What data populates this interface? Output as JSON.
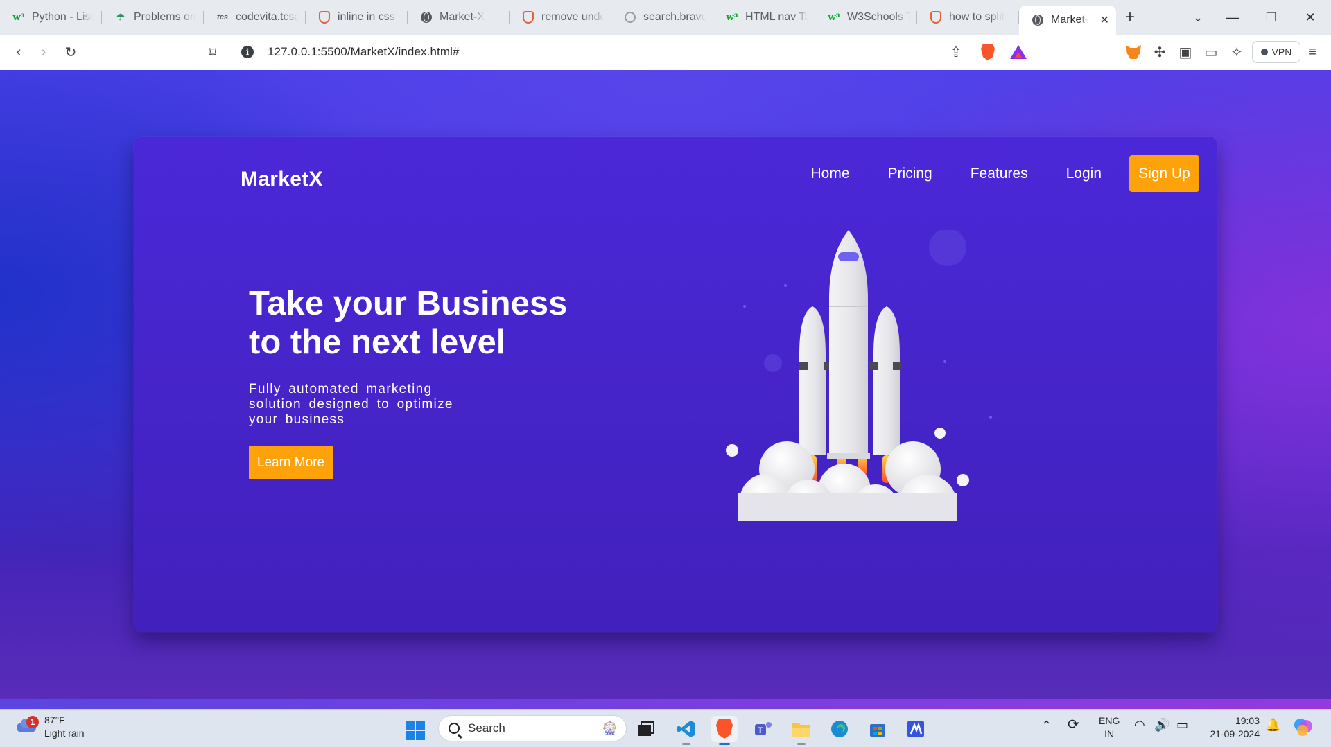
{
  "browser": {
    "tabs": [
      {
        "label": "Python - List",
        "icon": "w3schools-icon"
      },
      {
        "label": "Problems on",
        "icon": "umbrella-icon"
      },
      {
        "label": "codevita.tcsa",
        "icon": "tcs-icon"
      },
      {
        "label": "inline in css -",
        "icon": "brave-search-icon"
      },
      {
        "label": "Market-X",
        "icon": "globe-icon"
      },
      {
        "label": "remove unde",
        "icon": "brave-search-icon"
      },
      {
        "label": "search.brave",
        "icon": "search-icon"
      },
      {
        "label": "HTML nav Ta",
        "icon": "w3schools-icon"
      },
      {
        "label": "W3Schools T",
        "icon": "w3schools-icon"
      },
      {
        "label": "how to split",
        "icon": "brave-search-icon"
      }
    ],
    "active_tab": {
      "label": "Market-",
      "icon": "globe-icon"
    },
    "url": "127.0.0.1:5500/MarketX/index.html#",
    "vpn_label": "VPN"
  },
  "page": {
    "brand": "MarketX",
    "nav": [
      "Home",
      "Pricing",
      "Features",
      "Login"
    ],
    "signup": "Sign Up",
    "hero_title_line1": "Take your Business",
    "hero_title_line2": "to the next level",
    "hero_sub_line1": "Fully automated marketing",
    "hero_sub_line2": "solution designed to optimize",
    "hero_sub_line3": "your business",
    "cta": "Learn More",
    "colors": {
      "accent": "#fea20b",
      "background": "#4a28d8"
    }
  },
  "taskbar": {
    "weather_badge": "1",
    "weather_temp": "87°F",
    "weather_desc": "Light rain",
    "search_placeholder": "Search",
    "lang_line1": "ENG",
    "lang_line2": "IN",
    "time": "19:03",
    "date": "21-09-2024"
  }
}
